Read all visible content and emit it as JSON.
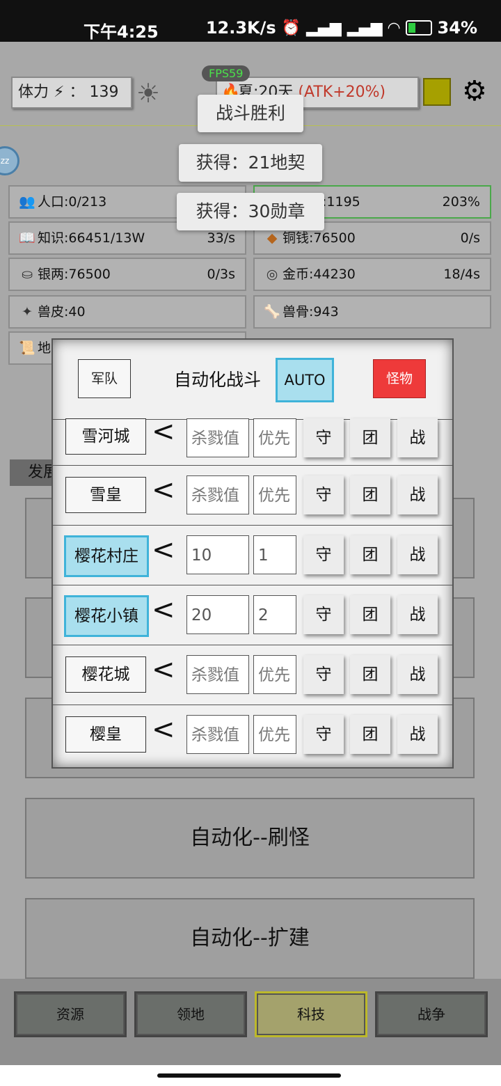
{
  "status_bar": {
    "time": "下午4:25",
    "net_speed": "12.3K/s",
    "battery": "34%",
    "icons": [
      "alarm-icon",
      "signal-icon",
      "signal-icon",
      "wifi-icon",
      "battery-icon"
    ]
  },
  "hud": {
    "fps": "FPS59",
    "stamina_label": "体力",
    "stamina_sep": "：",
    "stamina_value": "139",
    "season_text": "夏:20天 ",
    "season_bonus": "(ATK+20%)",
    "bubble": "zz"
  },
  "resources": [
    {
      "icon": "people-icon",
      "label": "人口:0/213",
      "rate": ""
    },
    {
      "icon": "smile-icon",
      "label": "幸福感:1195",
      "rate": "203%"
    },
    {
      "icon": "book-icon",
      "label": "知识:66451/13W",
      "rate": "33/s"
    },
    {
      "icon": "coin-icon",
      "label": "铜钱:76500",
      "rate": "0/s"
    },
    {
      "icon": "ingot-icon",
      "label": "银两:76500",
      "rate": "0/3s"
    },
    {
      "icon": "gold-icon",
      "label": "金币:44230",
      "rate": "18/4s"
    },
    {
      "icon": "pelt-icon",
      "label": "兽皮:40",
      "rate": ""
    },
    {
      "icon": "bone-icon",
      "label": "兽骨:943",
      "rate": ""
    },
    {
      "icon": "scroll-icon",
      "label": "地",
      "rate": ""
    }
  ],
  "dev_tab": "发展",
  "cards": [
    "自动化--刷怪",
    "自动化--扩建"
  ],
  "bottom_nav": [
    "资源",
    "领地",
    "科技",
    "战争"
  ],
  "toasts": [
    "战斗胜利",
    "获得：21地契",
    "获得：30勋章"
  ],
  "modal": {
    "army_button": "军队",
    "title": "自动化战斗",
    "auto_button": "AUTO",
    "monster_button": "怪物",
    "lt_symbol": "<",
    "actions": [
      "守",
      "团",
      "战"
    ],
    "rows": [
      {
        "city": "雪河城",
        "selected": false,
        "kill": "杀戮值",
        "priority": "优先"
      },
      {
        "city": "雪皇",
        "selected": false,
        "kill": "杀戮值",
        "priority": "优先"
      },
      {
        "city": "樱花村庄",
        "selected": true,
        "kill": "10",
        "priority": "1"
      },
      {
        "city": "樱花小镇",
        "selected": true,
        "kill": "20",
        "priority": "2"
      },
      {
        "city": "樱花城",
        "selected": false,
        "kill": "杀戮值",
        "priority": "优先"
      },
      {
        "city": "樱皇",
        "selected": false,
        "kill": "杀戮值",
        "priority": "优先"
      }
    ]
  }
}
